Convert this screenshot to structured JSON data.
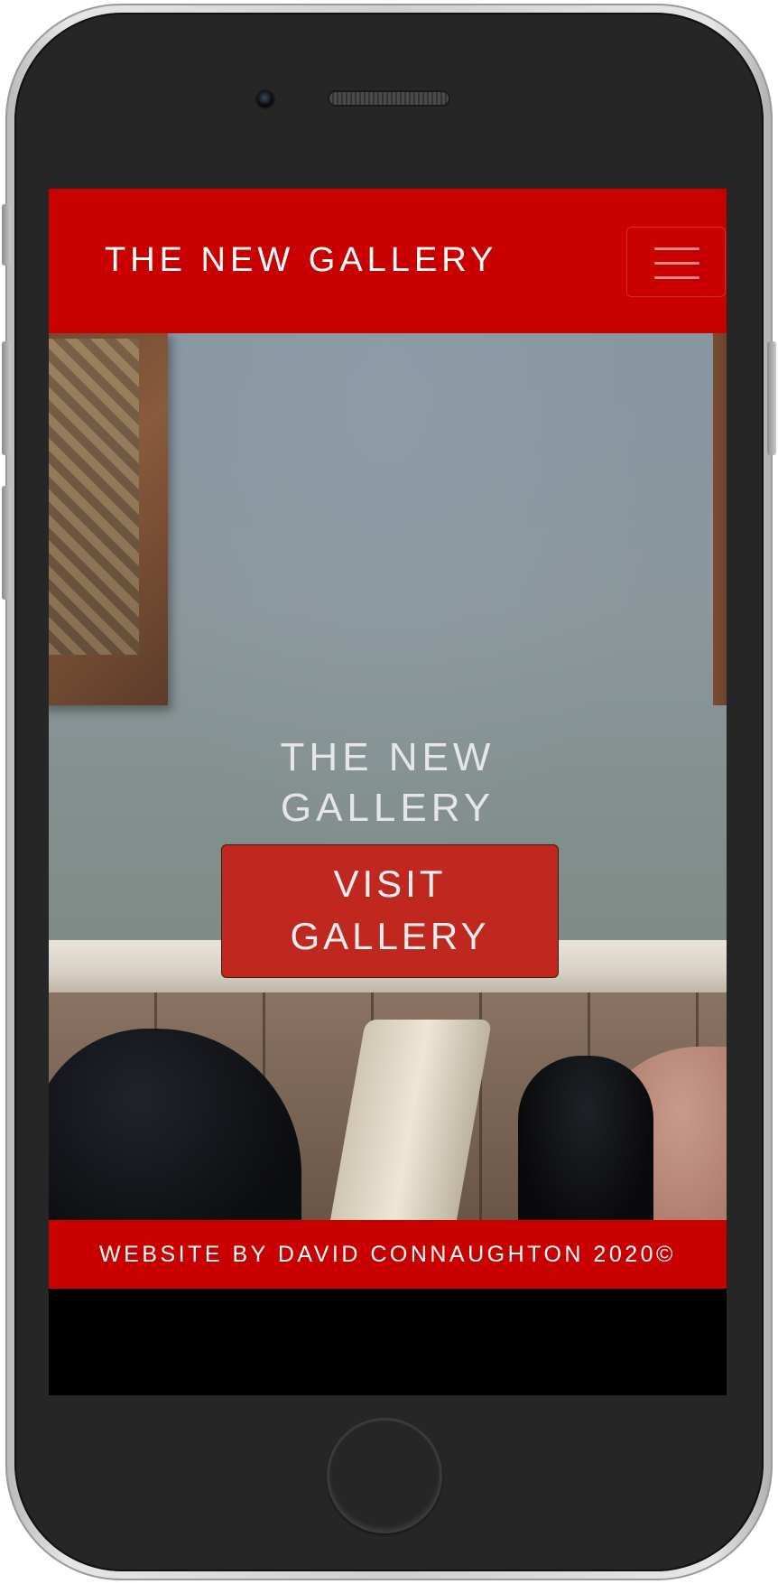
{
  "navbar": {
    "brand": "THE NEW GALLERY",
    "menu_icon": "hamburger-menu-icon"
  },
  "hero": {
    "title_line1": "THE NEW",
    "title_line2": "GALLERY",
    "button_line1": "VISIT",
    "button_line2": "GALLERY"
  },
  "footer": {
    "text": "WEBSITE BY DAVID CONNAUGHTON 2020©"
  },
  "colors": {
    "brand_red": "#c80000",
    "button_red": "#c0281f",
    "device_body": "#262626"
  }
}
